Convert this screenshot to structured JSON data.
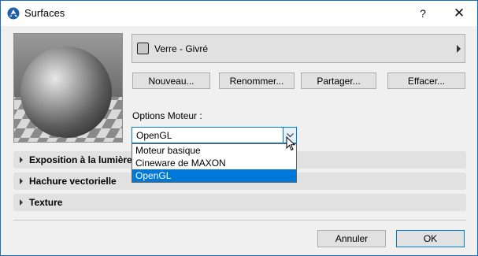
{
  "window": {
    "title": "Surfaces",
    "help_label": "?",
    "close_label": "✕"
  },
  "material": {
    "name": "Verre - Givré",
    "swatch_color": "#c8c8c8"
  },
  "actions": {
    "new_label": "Nouveau...",
    "rename_label": "Renommer...",
    "share_label": "Partager...",
    "delete_label": "Effacer..."
  },
  "engine": {
    "label": "Options Moteur :",
    "selected": "OpenGL",
    "options": [
      "Moteur basique",
      "Cineware de MAXON",
      "OpenGL"
    ],
    "highlighted_index": 2
  },
  "sections": [
    {
      "label": "Exposition à la lumière"
    },
    {
      "label": "Hachure vectorielle"
    },
    {
      "label": "Texture"
    }
  ],
  "footer": {
    "cancel_label": "Annuler",
    "ok_label": "OK"
  },
  "colors": {
    "accent": "#0078d7",
    "frame": "#1a6fb5"
  }
}
